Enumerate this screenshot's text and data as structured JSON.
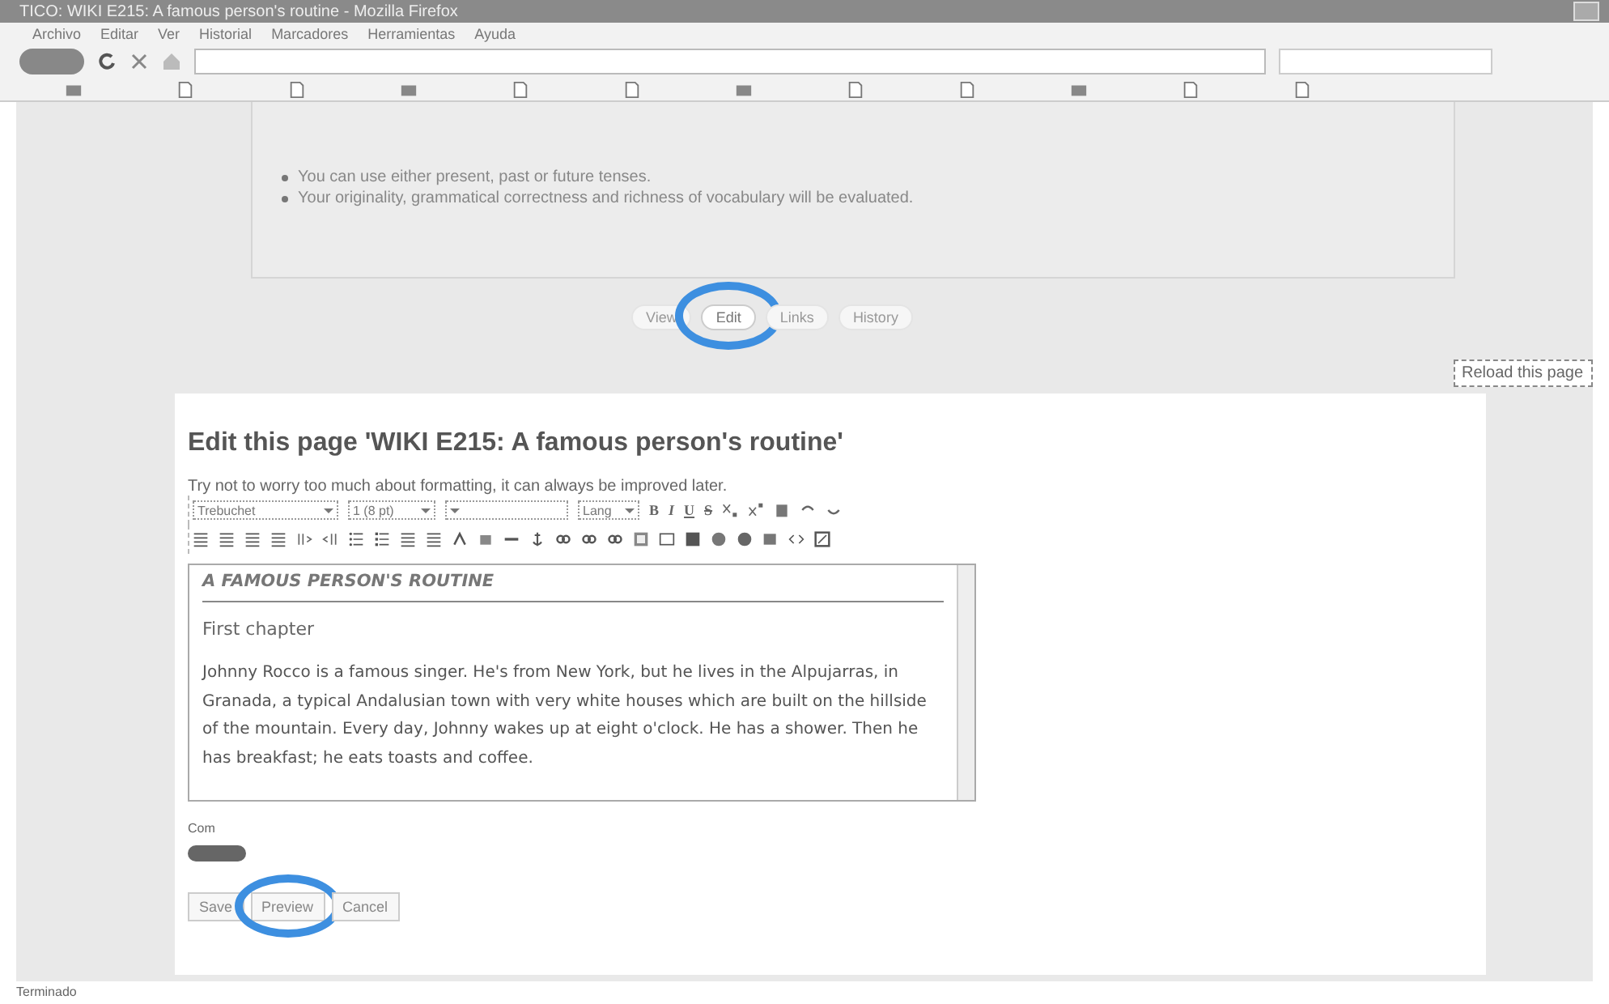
{
  "window": {
    "title": "TICO: WIKI E215: A famous person's routine - Mozilla Firefox"
  },
  "menu": [
    "Archivo",
    "Editar",
    "Ver",
    "Historial",
    "Marcadores",
    "Herramientas",
    "Ayuda"
  ],
  "instructions": [
    "You can use either present, past or future tenses.",
    "Your originality, grammatical correctness and richness of vocabulary will be evaluated."
  ],
  "tabs": [
    {
      "label": "View",
      "selected": false
    },
    {
      "label": "Edit",
      "selected": true
    },
    {
      "label": "Links",
      "selected": false
    },
    {
      "label": "History",
      "selected": false
    }
  ],
  "reload_button": "Reload this page",
  "editor": {
    "heading": "Edit this page 'WIKI E215: A famous person's routine'",
    "hint": "Try not to worry too much about formatting, it can always be improved later.",
    "font": "Trebuchet",
    "size": "1 (8 pt)",
    "lang": "Lang",
    "format_buttons": [
      "B",
      "I",
      "U",
      "S"
    ],
    "content_title": "A FAMOUS PERSON'S ROUTINE",
    "chapter": "First chapter",
    "paragraph": "Johnny Rocco is a famous singer. He's from New York, but he lives in the Alpujarras, in Granada, a typical Andalusian town with very white houses which are built on the hillside of the mountain. Every day, Johnny wakes up at eight o'clock. He has a shower. Then he has breakfast; he eats toasts and coffee.",
    "comment_label": "Com"
  },
  "actions": [
    {
      "label": "Save",
      "circled": false
    },
    {
      "label": "Preview",
      "circled": true
    },
    {
      "label": "Cancel",
      "circled": false
    }
  ],
  "status_bar": "Terminado"
}
